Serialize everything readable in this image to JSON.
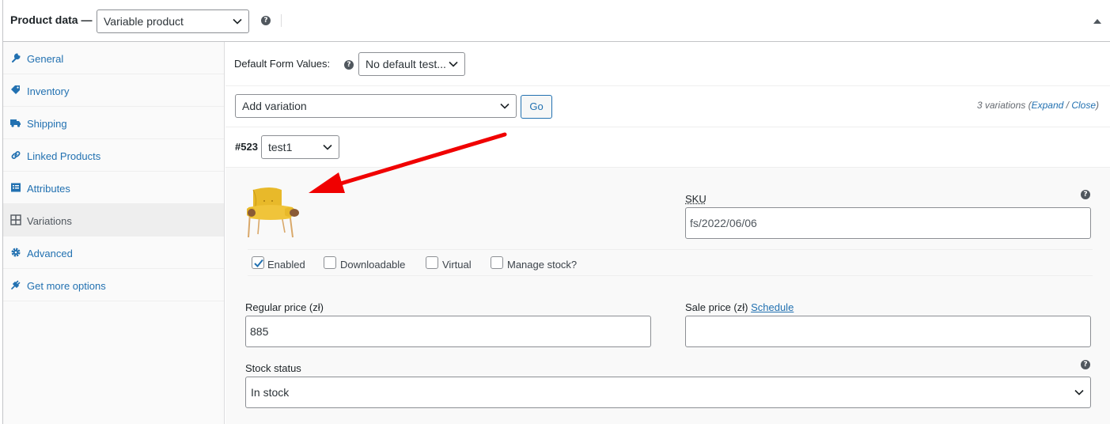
{
  "header": {
    "title": "Product data —",
    "product_type": "Variable product"
  },
  "sidebar": {
    "items": [
      {
        "label": "General",
        "icon": "wrench-icon"
      },
      {
        "label": "Inventory",
        "icon": "tag-icon"
      },
      {
        "label": "Shipping",
        "icon": "truck-icon"
      },
      {
        "label": "Linked Products",
        "icon": "link-icon"
      },
      {
        "label": "Attributes",
        "icon": "list-icon"
      },
      {
        "label": "Variations",
        "icon": "grid-icon",
        "active": true
      },
      {
        "label": "Advanced",
        "icon": "gear-icon"
      },
      {
        "label": "Get more options",
        "icon": "plugin-icon"
      }
    ]
  },
  "defaults": {
    "label": "Default Form Values:",
    "value": "No default test..."
  },
  "actions": {
    "bulk_action": "Add variation",
    "go_label": "Go",
    "count_text": "3 variations",
    "expand": "Expand",
    "close": "Close"
  },
  "variation": {
    "id": "#523",
    "attribute_value": "test1",
    "sku_label": "SKU",
    "sku_value": "fs/2022/06/06",
    "options": {
      "enabled": {
        "label": "Enabled",
        "checked": true
      },
      "downloadable": {
        "label": "Downloadable",
        "checked": false
      },
      "virtual": {
        "label": "Virtual",
        "checked": false
      },
      "manage_stock": {
        "label": "Manage stock?",
        "checked": false
      }
    },
    "regular_price_label": "Regular price (zł)",
    "regular_price_value": "885",
    "sale_price_label": "Sale price (zł)",
    "schedule_label": "Schedule",
    "sale_price_value": "",
    "stock_status_label": "Stock status",
    "stock_status_value": "In stock"
  },
  "colors": {
    "accent": "#2271b1",
    "annotation_arrow": "#f00000",
    "chair": "#e8b92a"
  }
}
